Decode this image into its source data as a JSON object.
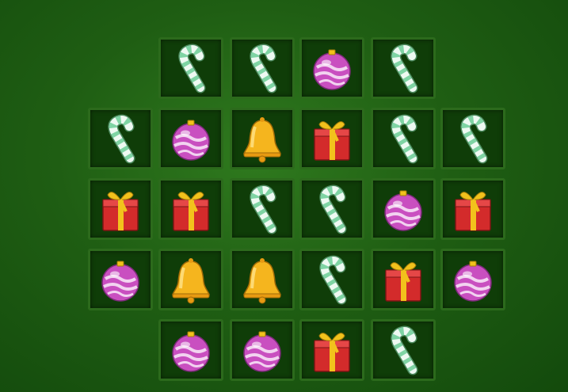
{
  "game": {
    "board": [
      {
        "row": 0,
        "col": 1,
        "item": "candy-cane"
      },
      {
        "row": 0,
        "col": 2,
        "item": "candy-cane"
      },
      {
        "row": 0,
        "col": 3,
        "item": "ornament"
      },
      {
        "row": 0,
        "col": 4,
        "item": "candy-cane"
      },
      {
        "row": 1,
        "col": 0,
        "item": "candy-cane"
      },
      {
        "row": 1,
        "col": 1,
        "item": "ornament"
      },
      {
        "row": 1,
        "col": 2,
        "item": "bell"
      },
      {
        "row": 1,
        "col": 3,
        "item": "gift"
      },
      {
        "row": 1,
        "col": 4,
        "item": "candy-cane"
      },
      {
        "row": 1,
        "col": 5,
        "item": "candy-cane"
      },
      {
        "row": 2,
        "col": 0,
        "item": "gift"
      },
      {
        "row": 2,
        "col": 1,
        "item": "gift"
      },
      {
        "row": 2,
        "col": 2,
        "item": "candy-cane"
      },
      {
        "row": 2,
        "col": 3,
        "item": "candy-cane"
      },
      {
        "row": 2,
        "col": 4,
        "item": "ornament"
      },
      {
        "row": 2,
        "col": 5,
        "item": "gift"
      },
      {
        "row": 3,
        "col": 0,
        "item": "ornament"
      },
      {
        "row": 3,
        "col": 1,
        "item": "bell"
      },
      {
        "row": 3,
        "col": 2,
        "item": "bell"
      },
      {
        "row": 3,
        "col": 3,
        "item": "candy-cane"
      },
      {
        "row": 3,
        "col": 4,
        "item": "gift"
      },
      {
        "row": 3,
        "col": 5,
        "item": "ornament"
      },
      {
        "row": 4,
        "col": 1,
        "item": "ornament"
      },
      {
        "row": 4,
        "col": 2,
        "item": "ornament"
      },
      {
        "row": 4,
        "col": 3,
        "item": "gift"
      },
      {
        "row": 4,
        "col": 4,
        "item": "candy-cane"
      }
    ],
    "colors": {
      "ornament": "#c94fc0",
      "gift": "#d32b2b",
      "ribbon": "#f2c21c",
      "bell": "#f5b51e",
      "candy-stripe": "#7fd4a4",
      "candy-base": "#eef9f2"
    }
  }
}
